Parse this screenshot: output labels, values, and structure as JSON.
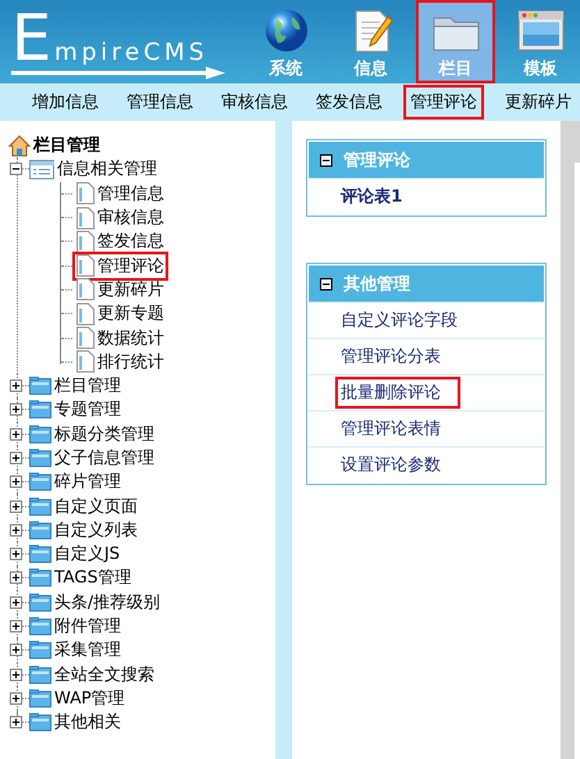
{
  "header": {
    "logo": "EmpireCMS",
    "nav": [
      {
        "label": "系统",
        "kind": "globe",
        "selected": false,
        "highlighted": false
      },
      {
        "label": "信息",
        "kind": "document",
        "selected": false,
        "highlighted": false
      },
      {
        "label": "栏目",
        "kind": "folder",
        "selected": true,
        "highlighted": true
      },
      {
        "label": "模板",
        "kind": "window",
        "selected": false,
        "highlighted": false
      }
    ]
  },
  "menu": [
    {
      "label": "增加信息",
      "highlighted": false
    },
    {
      "label": "管理信息",
      "highlighted": false
    },
    {
      "label": "审核信息",
      "highlighted": false
    },
    {
      "label": "签发信息",
      "highlighted": false
    },
    {
      "label": "管理评论",
      "highlighted": true
    },
    {
      "label": "更新碎片",
      "highlighted": false
    }
  ],
  "tree": {
    "root": "栏目管理",
    "items": [
      {
        "label": "信息相关管理",
        "expanded": true,
        "children": [
          {
            "label": "管理信息",
            "highlighted": false
          },
          {
            "label": "审核信息",
            "highlighted": false
          },
          {
            "label": "签发信息",
            "highlighted": false
          },
          {
            "label": "管理评论",
            "highlighted": true
          },
          {
            "label": "更新碎片",
            "highlighted": false
          },
          {
            "label": "更新专题",
            "highlighted": false
          },
          {
            "label": "数据统计",
            "highlighted": false
          },
          {
            "label": "排行统计",
            "highlighted": false
          }
        ]
      },
      {
        "label": "栏目管理",
        "expanded": false
      },
      {
        "label": "专题管理",
        "expanded": false
      },
      {
        "label": "标题分类管理",
        "expanded": false
      },
      {
        "label": "父子信息管理",
        "expanded": false
      },
      {
        "label": "碎片管理",
        "expanded": false
      },
      {
        "label": "自定义页面",
        "expanded": false
      },
      {
        "label": "自定义列表",
        "expanded": false
      },
      {
        "label": "自定义JS",
        "expanded": false
      },
      {
        "label": "TAGS管理",
        "expanded": false
      },
      {
        "label": "头条/推荐级别",
        "expanded": false
      },
      {
        "label": "附件管理",
        "expanded": false
      },
      {
        "label": "采集管理",
        "expanded": false
      },
      {
        "label": "全站全文搜索",
        "expanded": false
      },
      {
        "label": "WAP管理",
        "expanded": false
      },
      {
        "label": "其他相关",
        "expanded": false
      }
    ]
  },
  "panels": [
    {
      "title": "管理评论",
      "links": [
        {
          "label": "评论表1",
          "bold": true,
          "highlighted": false
        }
      ]
    },
    {
      "title": "其他管理",
      "links": [
        {
          "label": "自定义评论字段",
          "bold": false,
          "highlighted": false
        },
        {
          "label": "管理评论分表",
          "bold": false,
          "highlighted": false
        },
        {
          "label": "批量删除评论",
          "bold": false,
          "highlighted": true
        },
        {
          "label": "管理评论表情",
          "bold": false,
          "highlighted": false
        },
        {
          "label": "设置评论参数",
          "bold": false,
          "highlighted": false
        }
      ]
    }
  ]
}
